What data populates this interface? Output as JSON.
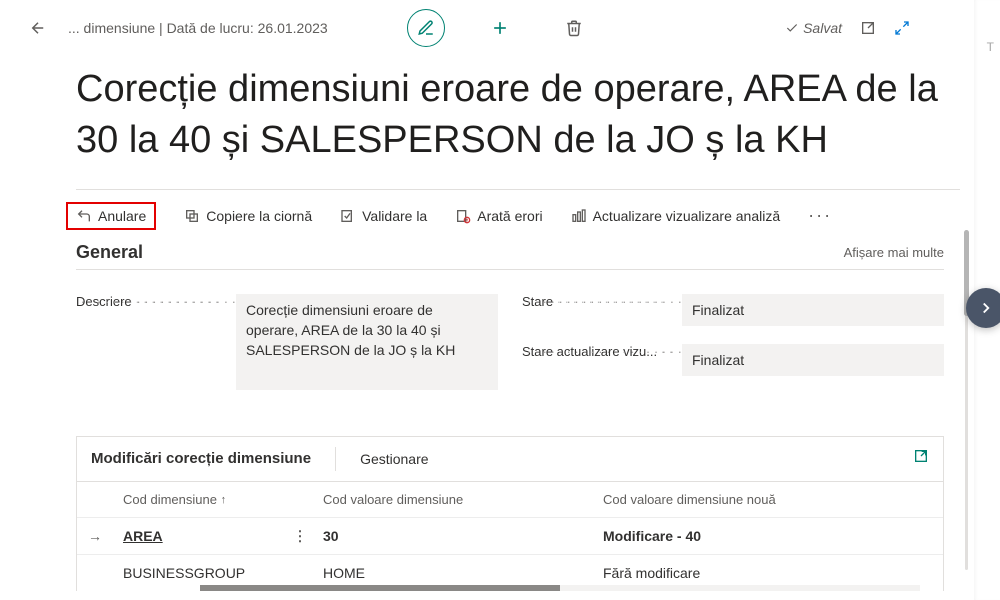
{
  "header": {
    "breadcrumb": "... dimensiune | Dată de lucru: 26.01.2023",
    "saved_label": "Salvat",
    "title": "Corecție dimensiuni eroare de operare, AREA de la 30 la 40 și SALESPERSON de la JO ș la KH"
  },
  "actions": {
    "undo": "Anulare",
    "copy": "Copiere la ciornă",
    "validate": "Validare la",
    "show_errors": "Arată erori",
    "refresh_view": "Actualizare vizualizare analiză"
  },
  "general": {
    "section_title": "General",
    "show_more": "Afișare mai multe",
    "fields": {
      "description_label": "Descriere",
      "description_value": "Corecție dimensiuni eroare de operare, AREA de la 30 la 40 și SALESPERSON de la JO ș la KH",
      "state_label": "Stare",
      "state_value": "Finalizat",
      "viz_state_label": "Stare actualizare vizu...",
      "viz_state_value": "Finalizat"
    }
  },
  "subgrid": {
    "title": "Modificări corecție dimensiune",
    "manage": "Gestionare",
    "columns": {
      "dim_code": "Cod dimensiune",
      "dim_value": "Cod valoare dimensiune",
      "new_dim_value": "Cod valoare dimensiune nouă"
    },
    "rows": [
      {
        "active": true,
        "dim": "AREA",
        "val": "30",
        "new": "Modificare - 40"
      },
      {
        "active": false,
        "dim": "BUSINESSGROUP",
        "val": "HOME",
        "new": "Fără modificare"
      }
    ]
  },
  "right_hints": {
    "h1": "",
    "h2": "T"
  }
}
